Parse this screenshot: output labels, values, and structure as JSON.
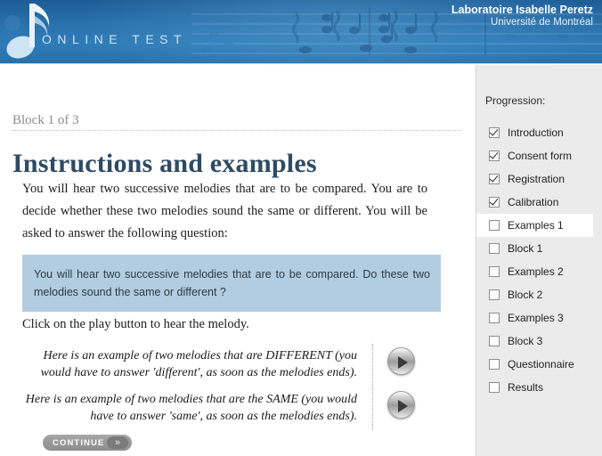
{
  "header": {
    "brand_text": "ONLINE TEST",
    "lab_name": "Laboratoire Isabelle Peretz",
    "lab_university": "Université de Montréal",
    "logo_icon": "music-note-icon",
    "background_icon": "sheet-music-icon",
    "bg_color_top": "#1d5d96",
    "bg_color_mid": "#2f7cb8"
  },
  "main": {
    "block_label": "Block 1 of 3",
    "title": "Instructions and examples",
    "intro_paragraph": "You will hear two successive melodies that are to be compared. You are to decide whether these two melodies sound the same or different. You will be asked to answer the following question:",
    "question_box": {
      "text": "You will hear two successive melodies that are to be compared. Do these two melodies sound the same or different ?",
      "bg_color": "#b2cde1"
    },
    "click_instruction": "Click on the play button to hear the melody.",
    "examples": [
      {
        "text": "Here is an example of two melodies that are DIFFERENT (you would have to answer 'different', as soon as the melodies ends).",
        "play_icon": "play-icon"
      },
      {
        "text": "Here is an example of two melodies that are the SAME (you would have to answer 'same', as soon as the melodies ends).",
        "play_icon": "play-icon"
      }
    ],
    "continue_button": {
      "label": "CONTINUE",
      "chevron": "»"
    },
    "title_color": "#2e4b63"
  },
  "sidebar": {
    "title": "Progression:",
    "bg_color": "#ebebeb",
    "items": [
      {
        "label": "Introduction",
        "checked": true,
        "current": false
      },
      {
        "label": "Consent form",
        "checked": true,
        "current": false
      },
      {
        "label": "Registration",
        "checked": true,
        "current": false
      },
      {
        "label": "Calibration",
        "checked": true,
        "current": false
      },
      {
        "label": "Examples 1",
        "checked": false,
        "current": true
      },
      {
        "label": "Block 1",
        "checked": false,
        "current": false
      },
      {
        "label": "Examples 2",
        "checked": false,
        "current": false
      },
      {
        "label": "Block 2",
        "checked": false,
        "current": false
      },
      {
        "label": "Examples 3",
        "checked": false,
        "current": false
      },
      {
        "label": "Block 3",
        "checked": false,
        "current": false
      },
      {
        "label": "Questionnaire",
        "checked": false,
        "current": false
      },
      {
        "label": "Results",
        "checked": false,
        "current": false
      }
    ]
  }
}
